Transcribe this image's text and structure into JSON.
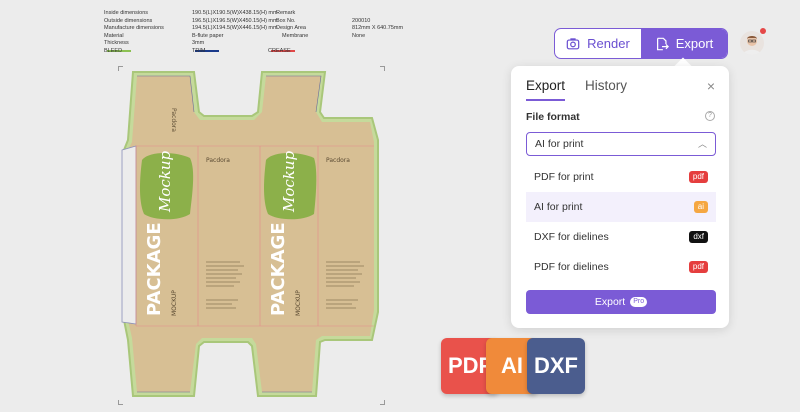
{
  "spec": {
    "rows": [
      {
        "k1": "Inside dimensions",
        "v1": "190.5(L)X190.5(W)X438.15(H) mm",
        "k2": "Remark",
        "v2": ""
      },
      {
        "k1": "Outside dimensions",
        "v1": "196.5(L)X196.5(W)X450.15(H) mm",
        "k2": "Box No.",
        "v2": "200010"
      },
      {
        "k1": "Manufacture dimensions",
        "v1": "194.5(L)X194.5(W)X446.15(H) mm",
        "k2": "Design Area",
        "v2": "812mm X 640.75mm"
      },
      {
        "k1": "Material",
        "v1": "B-flute paper",
        "k2": "Membrane",
        "v2": "None"
      },
      {
        "k1": "Thickness",
        "v1": "3mm",
        "k2": "",
        "v2": ""
      }
    ],
    "legend": [
      {
        "label": "BLEED",
        "color": "#8cc152"
      },
      {
        "label": "TRIM",
        "color": "#1a3a8a"
      },
      {
        "label": "CREASE",
        "color": "#e04848"
      }
    ]
  },
  "dieline": {
    "brand": "Pacdora",
    "product": "PACKAGE",
    "script": "Mockup",
    "mockup_title": "MOCKUP",
    "colors": {
      "kraft": "#d7bf94",
      "bleed": "#b8d58c",
      "label": "#8cb04a"
    }
  },
  "toolbar": {
    "render_label": "Render",
    "export_label": "Export",
    "render_icon": "camera-icon",
    "export_icon": "export-file-icon"
  },
  "panel": {
    "tab_export": "Export",
    "tab_history": "History",
    "close": "×",
    "file_format_label": "File format",
    "info": "?",
    "selected": "AI for print",
    "options": [
      {
        "label": "PDF for print",
        "badge": "pdf",
        "badge_color": "#e53e3e"
      },
      {
        "label": "AI for print",
        "badge": "ai",
        "badge_color": "#f5a742"
      },
      {
        "label": "DXF for dielines",
        "badge": "dxf",
        "badge_color": "#111111"
      },
      {
        "label": "PDF for dielines",
        "badge": "pdf",
        "badge_color": "#e53e3e"
      }
    ],
    "export_button": "Export",
    "pro_badge": "Pro"
  },
  "file_icons": [
    {
      "label": "PDF",
      "color": "#e9524b"
    },
    {
      "label": "AI",
      "color": "#f08a3a"
    },
    {
      "label": "DXF",
      "color": "#4b5d8e"
    }
  ],
  "colors": {
    "accent": "#7b5bd6"
  }
}
